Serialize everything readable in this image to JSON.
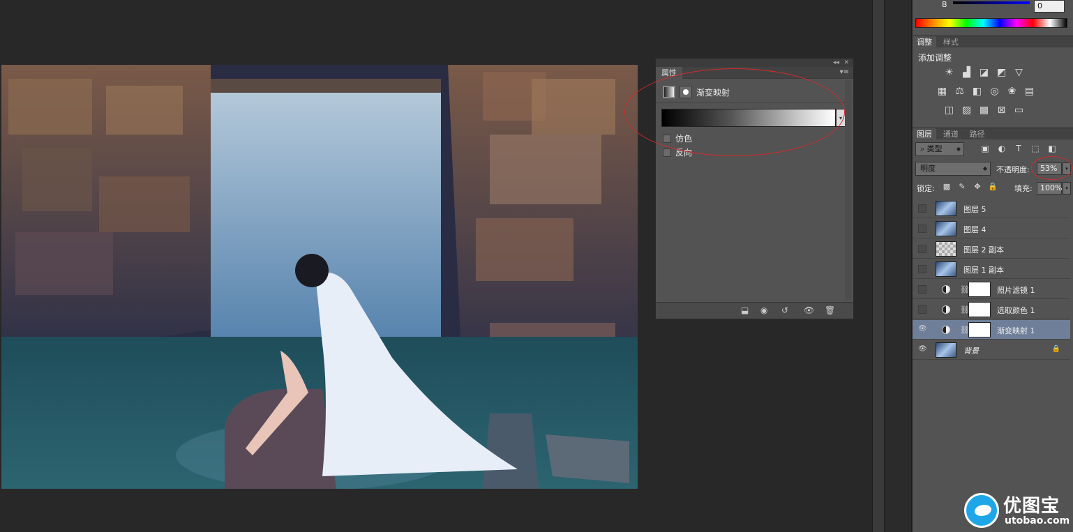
{
  "canvas": {
    "image_desc": "waterfall-portrait"
  },
  "properties_panel": {
    "tab_label": "属性",
    "adjustment_name": "渐变映射",
    "dither_label": "仿色",
    "reverse_label": "反向",
    "dither_checked": false,
    "reverse_checked": false
  },
  "color_panel": {
    "channel_label": "B",
    "channel_value": "0"
  },
  "adjustments_panel": {
    "tabs": [
      "调整",
      "样式"
    ],
    "title": "添加调整"
  },
  "layers_panel": {
    "tabs": [
      "图层",
      "通道",
      "路径"
    ],
    "filter_label": "类型",
    "blend_mode": "明度",
    "opacity_label": "不透明度:",
    "opacity_value": "53%",
    "lock_label": "锁定:",
    "fill_label": "填充:",
    "fill_value": "100%",
    "layers": [
      {
        "name": "图层 5",
        "visible": false,
        "kind": "image",
        "selected": false
      },
      {
        "name": "图层 4",
        "visible": false,
        "kind": "image",
        "selected": false
      },
      {
        "name": "图层 2 副本",
        "visible": false,
        "kind": "transparent",
        "selected": false
      },
      {
        "name": "图层 1 副本",
        "visible": false,
        "kind": "image",
        "selected": false
      },
      {
        "name": "照片滤镜 1",
        "visible": false,
        "kind": "adjustment",
        "selected": false
      },
      {
        "name": "选取颜色 1",
        "visible": false,
        "kind": "adjustment",
        "selected": false
      },
      {
        "name": "渐变映射 1",
        "visible": true,
        "kind": "adjustment",
        "selected": true
      },
      {
        "name": "背景",
        "visible": true,
        "kind": "background",
        "selected": false,
        "locked": true
      }
    ]
  },
  "watermark": {
    "cn": "优图宝",
    "en": "utobao.com"
  },
  "colors": {
    "workspace_bg": "#282828",
    "panel_bg": "#535353",
    "selected_layer": "#6f7f99",
    "annotation": "#d42a2a",
    "logo_blue": "#1fa6e8"
  }
}
